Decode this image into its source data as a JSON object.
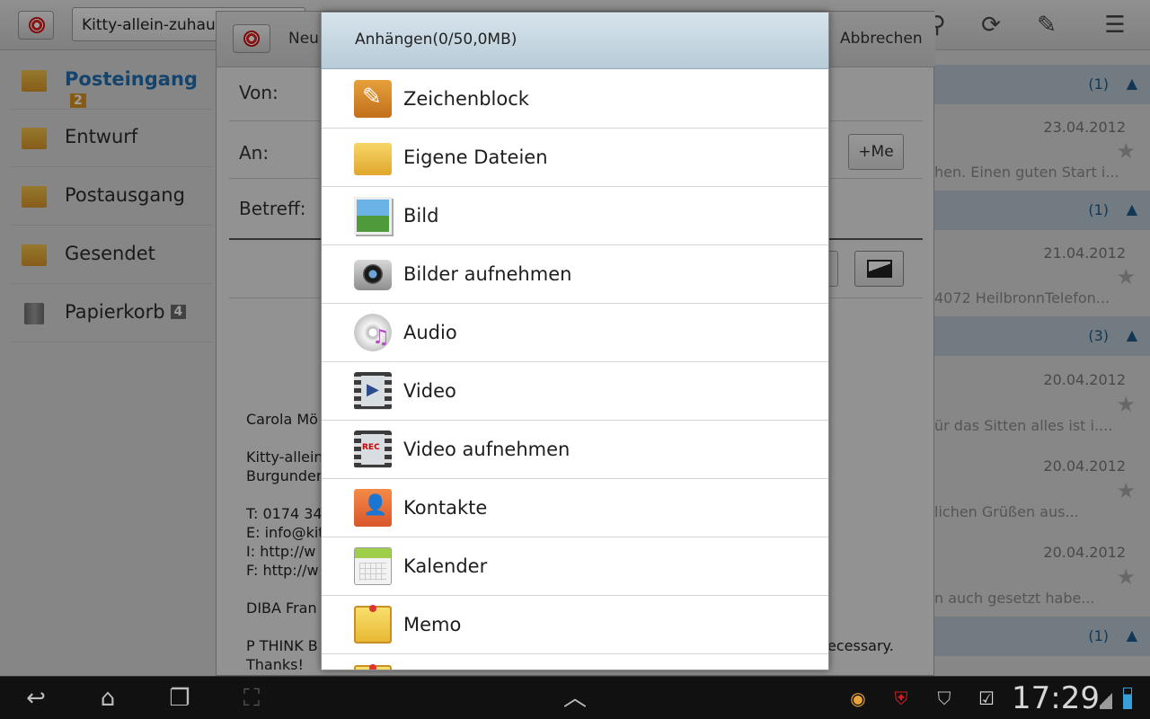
{
  "topbar": {
    "account": "Kitty-allein-zuhaus",
    "icons": [
      "search-icon",
      "refresh-icon",
      "compose-icon",
      "menu-icon"
    ]
  },
  "folders": [
    {
      "label": "Posteingang",
      "count": "2",
      "active": true
    },
    {
      "label": "Entwurf"
    },
    {
      "label": "Postausgang"
    },
    {
      "label": "Gesendet"
    },
    {
      "label": "Papierkorb",
      "count": "4"
    }
  ],
  "mail_list": {
    "groups": [
      {
        "count": "(1)"
      },
      {
        "count": "(1)"
      },
      {
        "count": "(3)"
      },
      {
        "count": "(1)"
      }
    ],
    "items": [
      {
        "date": "23.04.2012",
        "snippet": "hen. Einen guten Start i..."
      },
      {
        "date": "21.04.2012",
        "snippet": "4072 HeilbronnTelefon..."
      },
      {
        "date": "20.04.2012",
        "snippet": "ür das Sitten alles ist i...."
      },
      {
        "date": "20.04.2012",
        "snippet": "lichen Grüßen aus..."
      },
      {
        "date": "20.04.2012",
        "snippet": "n auch gesetzt habe..."
      }
    ]
  },
  "compose": {
    "title": "Neu",
    "cancel": "Abbrechen",
    "from_label": "Von:",
    "to_label": "An:",
    "subject_label": "Betreff:",
    "me_button": "+Me",
    "signature": [
      "Carola Mö",
      "Kitty-allein",
      "Burgunder",
      "T: 0174 34",
      "E: info@kit",
      "I: http://w",
      "F: http://w",
      "DIBA Fran",
      "P THINK B",
      "Thanks!"
    ],
    "signature_right": "ecessary."
  },
  "dialog": {
    "title": "Anhängen(0/50,0MB)",
    "options": [
      {
        "label": "Zeichenblock",
        "icon": "sketchbook-icon"
      },
      {
        "label": "Eigene Dateien",
        "icon": "folder-icon"
      },
      {
        "label": "Bild",
        "icon": "image-icon"
      },
      {
        "label": "Bilder aufnehmen",
        "icon": "camera-icon"
      },
      {
        "label": "Audio",
        "icon": "audio-icon"
      },
      {
        "label": "Video",
        "icon": "video-icon"
      },
      {
        "label": "Video aufnehmen",
        "icon": "video-record-icon"
      },
      {
        "label": "Kontakte",
        "icon": "contacts-icon"
      },
      {
        "label": "Kalender",
        "icon": "calendar-icon"
      },
      {
        "label": "Memo",
        "icon": "memo-icon"
      }
    ]
  },
  "sysbar": {
    "time": "17:29",
    "icons": [
      "back-icon",
      "home-icon",
      "recent-apps-icon",
      "screenshot-icon",
      "up-arrow-icon",
      "notification-icon",
      "security-icon",
      "shield-icon",
      "task-icon",
      "signal-icon",
      "battery-icon"
    ]
  }
}
